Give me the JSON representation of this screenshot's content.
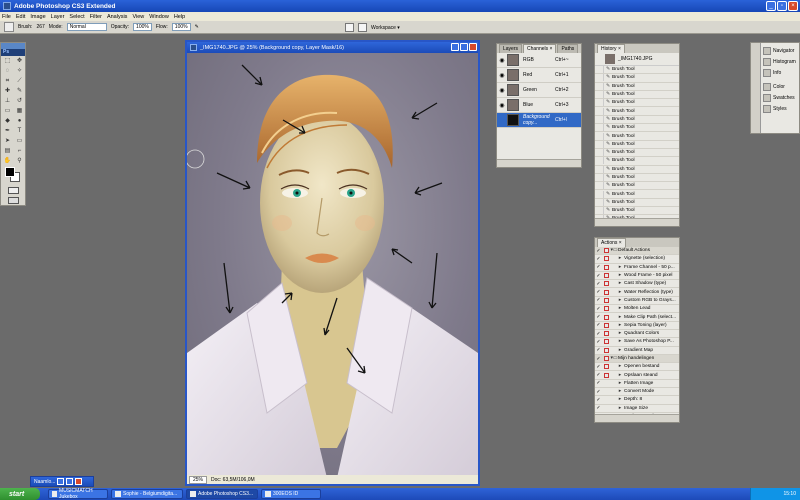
{
  "app": {
    "title": "Adobe Photoshop CS3 Extended"
  },
  "menu": [
    "File",
    "Edit",
    "Image",
    "Layer",
    "Select",
    "Filter",
    "Analysis",
    "View",
    "Window",
    "Help"
  ],
  "options": {
    "brush_label": "Brush:",
    "brush_size": "267",
    "mode_label": "Mode:",
    "mode_value": "Normal",
    "opacity_label": "Opacity:",
    "opacity_value": "100%",
    "flow_label": "Flow:",
    "flow_value": "100%",
    "workspace_label": "Workspace ▾"
  },
  "toolbox": {
    "label": "Ps"
  },
  "document": {
    "title": "_IMG1740.JPG @ 25% (Background copy, Layer Mask/16)",
    "zoom": "25%",
    "doc_info": "Doc: 63,5M/106,0M"
  },
  "channels_palette": {
    "tabs": [
      "Layers",
      "Channels ×",
      "Paths"
    ],
    "rows": [
      {
        "name": "RGB",
        "shortcut": "Ctrl+~"
      },
      {
        "name": "Red",
        "shortcut": "Ctrl+1"
      },
      {
        "name": "Green",
        "shortcut": "Ctrl+2"
      },
      {
        "name": "Blue",
        "shortcut": "Ctrl+3"
      },
      {
        "name": "Background copy...",
        "shortcut": "Ctrl+\\"
      }
    ]
  },
  "history_palette": {
    "tab": "History ×",
    "snapshot": "_IMG1740.JPG",
    "items": [
      "Brush Tool",
      "Brush Tool",
      "Brush Tool",
      "Brush Tool",
      "Brush Tool",
      "Brush Tool",
      "Brush Tool",
      "Brush Tool",
      "Brush Tool",
      "Brush Tool",
      "Brush Tool",
      "Brush Tool",
      "Brush Tool",
      "Brush Tool",
      "Brush Tool",
      "Brush Tool",
      "Brush Tool",
      "Brush Tool",
      "Brush Tool"
    ]
  },
  "actions_palette": {
    "tab": "Actions ×",
    "items": [
      {
        "label": "Default Actions",
        "set": true
      },
      {
        "label": "Vignette (selection)",
        "set": false
      },
      {
        "label": "Frame Channel - 50 p...",
        "set": false
      },
      {
        "label": "Wood Frame - 50 pixel",
        "set": false
      },
      {
        "label": "Cast Shadow (type)",
        "set": false
      },
      {
        "label": "Water Reflection (type)",
        "set": false
      },
      {
        "label": "Custom RGB to Grays...",
        "set": false
      },
      {
        "label": "Molten Lead",
        "set": false
      },
      {
        "label": "Make Clip Path (select...",
        "set": false
      },
      {
        "label": "Sepia Toning (layer)",
        "set": false
      },
      {
        "label": "Quadrant Colors",
        "set": false
      },
      {
        "label": "Save As Photoshop P...",
        "set": false
      },
      {
        "label": "Gradient Map",
        "set": false
      },
      {
        "label": "Mijn handelingen",
        "set": true
      },
      {
        "label": "Openen bestand",
        "set": false
      },
      {
        "label": "Opslaan steand",
        "set": false
      },
      {
        "label": "Flatten Image",
        "set": false
      },
      {
        "label": "Convert Mode",
        "set": false
      },
      {
        "label": "Depth: 8",
        "set": false
      },
      {
        "label": "Image Size",
        "set": false
      },
      {
        "label": "Unsharp Mask",
        "set": false
      }
    ]
  },
  "dock": {
    "items": [
      "Navigator",
      "Histogram",
      "Info",
      "Color",
      "Swatches",
      "Styles"
    ]
  },
  "minimized_window": {
    "label": "Naamlo..."
  },
  "taskbar": {
    "start": "start",
    "tasks": [
      "MUSICMATCH Jukebox",
      "Sophie - Belgiumdigita...",
      "Adobe Photoshop CS3...",
      "300EOS ID"
    ],
    "clock": "15:10"
  },
  "colors": {
    "title_blue": "#2a62d8",
    "selection_blue": "#3169c6",
    "start_green": "#3da33d",
    "tray_blue": "#0f94e7"
  }
}
